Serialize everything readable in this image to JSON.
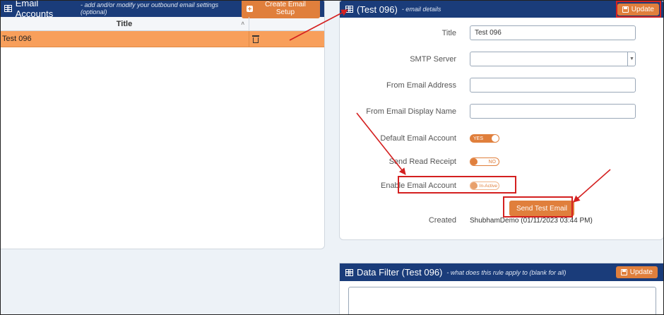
{
  "left": {
    "header_title": "Email Accounts",
    "header_subtitle": "- add and/or modify your outbound email settings (optional)",
    "create_button": "Create Email Setup",
    "table": {
      "column_title": "Title",
      "sort_glyph": "˄",
      "rows": [
        {
          "title": "Test 096"
        }
      ]
    }
  },
  "right": {
    "header_title": "(Test 096)",
    "header_subtitle": "- email details",
    "update_button": "Update",
    "fields": {
      "title_label": "Title",
      "title_value": "Test 096",
      "smtp_label": "SMTP Server",
      "smtp_value": "",
      "from_address_label": "From Email Address",
      "from_address_value": "",
      "from_display_label": "From Email Display Name",
      "from_display_value": "",
      "default_label": "Default Email Account",
      "default_toggle": "YES",
      "receipt_label": "Send Read Receipt",
      "receipt_toggle": "NO",
      "enable_label": "Enable Email Account",
      "enable_toggle": "In-Active",
      "send_test_button": "Send Test Email",
      "created_label": "Created",
      "created_value": "ShubhamDemo (01/11/2023 03:44 PM)"
    }
  },
  "filter": {
    "header_title": "Data Filter (Test 096)",
    "header_subtitle": "- what does this rule apply to (blank for all)",
    "update_button": "Update"
  },
  "colors": {
    "header": "#1a3c7a",
    "accent": "#e07f3c",
    "selected_row": "#f89f5b",
    "annotation": "#d42020"
  }
}
